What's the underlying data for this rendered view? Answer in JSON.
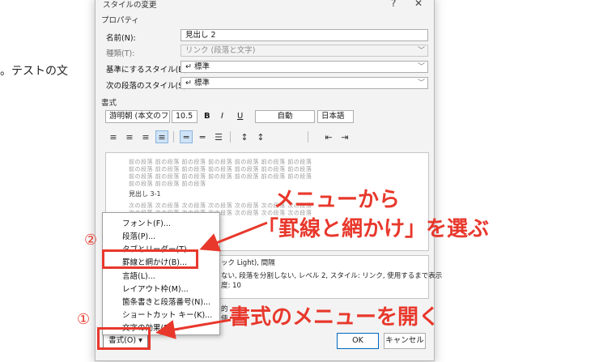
{
  "background": {
    "doc_text": "。テストの文"
  },
  "dialog": {
    "title": "スタイルの変更",
    "help_glyph": "?",
    "close_glyph": "✕",
    "properties_label": "プロパティ",
    "name_label": "名前(N):",
    "name_value": "見出し 2",
    "type_label": "種類(T):",
    "type_value": "リンク (段落と文字)",
    "base_label": "基準にするスタイル(B):",
    "base_value": "↵ 標準",
    "next_label": "次の段落のスタイル(S):",
    "next_value": "↵ 標準",
    "format_label": "書式",
    "font_value": "游明朝 (本文のフ",
    "size_value": "10.5",
    "bold": "B",
    "italic": "I",
    "underline": "U",
    "color_value": "自動",
    "lang_value": "日本語",
    "preview": {
      "prev_lines": [
        "前の段落 前の段落 前の段落 前の段落 前の段落 前の段落 前の段落",
        "前の段落 前の段落 前の段落 前の段落 前の段落 前の段落 前の段落",
        "前の段落 前の段落 前の段落 前の段落 前の段落 前の段落 前の段落",
        "前の段落 前の段落 前の段落"
      ],
      "heading": "見出し 3-1",
      "next_lines": [
        "次の段落 次の段落 次の段落 次の段落 次の段落 次の段落 次の段落",
        "次の段落 次の段落 次の段落 次の段落 次の段落 次の段落 次の段落"
      ]
    },
    "desc_lines": [
      "ック Light), 間隔",
      "ない, 段落を分割しない, レベル 2, スタイル: リンク, 使用するまで表示",
      "度: 10"
    ],
    "checks_text": "的",
    "checks_text2": "使",
    "format_button": "書式(O) ▾",
    "ok": "OK",
    "cancel": "キャンセル"
  },
  "menu": {
    "items": [
      "フォント(F)...",
      "段落(P)...",
      "タブとリーダー(T)...",
      "罫線と網かけ(B)...",
      "言語(L)...",
      "レイアウト枠(M)...",
      "箇条書きと段落番号(N)...",
      "ショートカット キー(K)...",
      "文字の効果(E)..."
    ]
  },
  "annotations": {
    "label_1": "①",
    "label_2": "②",
    "text_top_line1": "メニューから",
    "text_top_line2": "「罫線と網かけ」を選ぶ",
    "text_bottom": "書式のメニューを開く",
    "color": "#e8382c"
  }
}
